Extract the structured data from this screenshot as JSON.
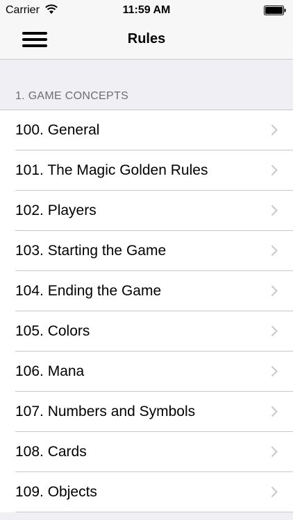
{
  "status_bar": {
    "carrier": "Carrier",
    "time": "11:59 AM",
    "wifi_icon": "wifi-icon",
    "battery_icon": "battery-icon"
  },
  "nav_bar": {
    "title": "Rules",
    "menu_icon": "hamburger-menu-icon"
  },
  "section": {
    "header": "1. GAME CONCEPTS"
  },
  "rules": [
    {
      "label": "100. General"
    },
    {
      "label": "101. The Magic Golden Rules"
    },
    {
      "label": "102. Players"
    },
    {
      "label": "103. Starting the Game"
    },
    {
      "label": "104. Ending the Game"
    },
    {
      "label": "105. Colors"
    },
    {
      "label": "106. Mana"
    },
    {
      "label": "107. Numbers and Symbols"
    },
    {
      "label": "108. Cards"
    },
    {
      "label": "109. Objects"
    }
  ],
  "colors": {
    "background": "#efeff4",
    "separator": "#c8c7cc",
    "chevron": "#c7c7cc",
    "section_text": "#6d6d72"
  }
}
